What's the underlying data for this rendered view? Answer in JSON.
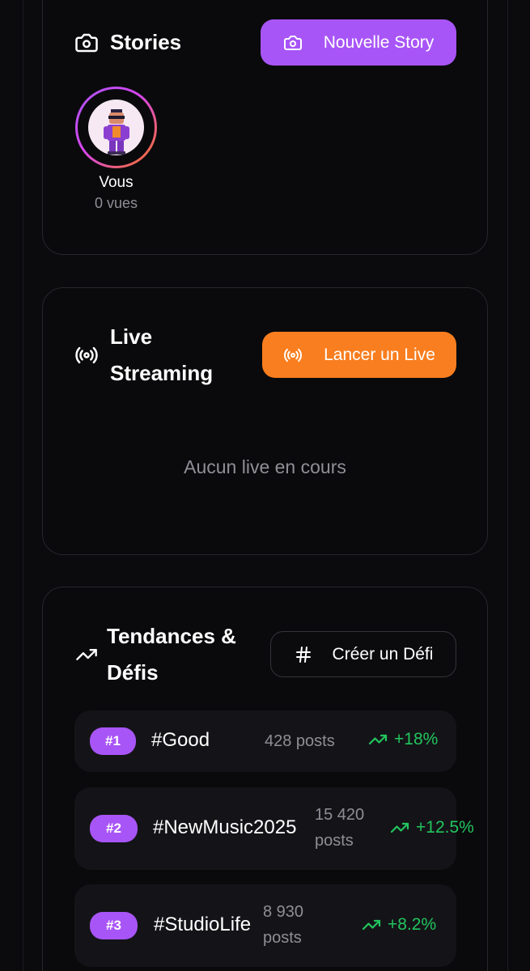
{
  "stories": {
    "title": "Stories",
    "new_button_label": "Nouvelle Story",
    "items": [
      {
        "name": "Vous",
        "views": "0 vues"
      }
    ]
  },
  "live": {
    "title_line1": "Live",
    "title_line2": "Streaming",
    "button_label": "Lancer un Live",
    "empty_message": "Aucun live en cours"
  },
  "trends": {
    "title_line1": "Tendances &",
    "title_line2": "Défis",
    "create_button_label": "Créer un Défi",
    "items": [
      {
        "rank": "#1",
        "tag": "#Good",
        "posts_line1": "428 posts",
        "posts_line2": "",
        "growth": "+18%"
      },
      {
        "rank": "#2",
        "tag": "#NewMusic2025",
        "posts_line1": "15 420",
        "posts_line2": "posts",
        "growth": "+12.5%"
      },
      {
        "rank": "#3",
        "tag": "#StudioLife",
        "posts_line1": "8 930",
        "posts_line2": "posts",
        "growth": "+8.2%"
      }
    ]
  },
  "colors": {
    "background": "#0b0b0e",
    "accent_purple": "#a855f7",
    "accent_orange": "#f97e1f",
    "growth_green": "#22c55e"
  },
  "icons": {
    "stories": "camera-icon",
    "live": "broadcast-icon",
    "trends": "trending-up-icon",
    "create_challenge": "hash-icon"
  }
}
